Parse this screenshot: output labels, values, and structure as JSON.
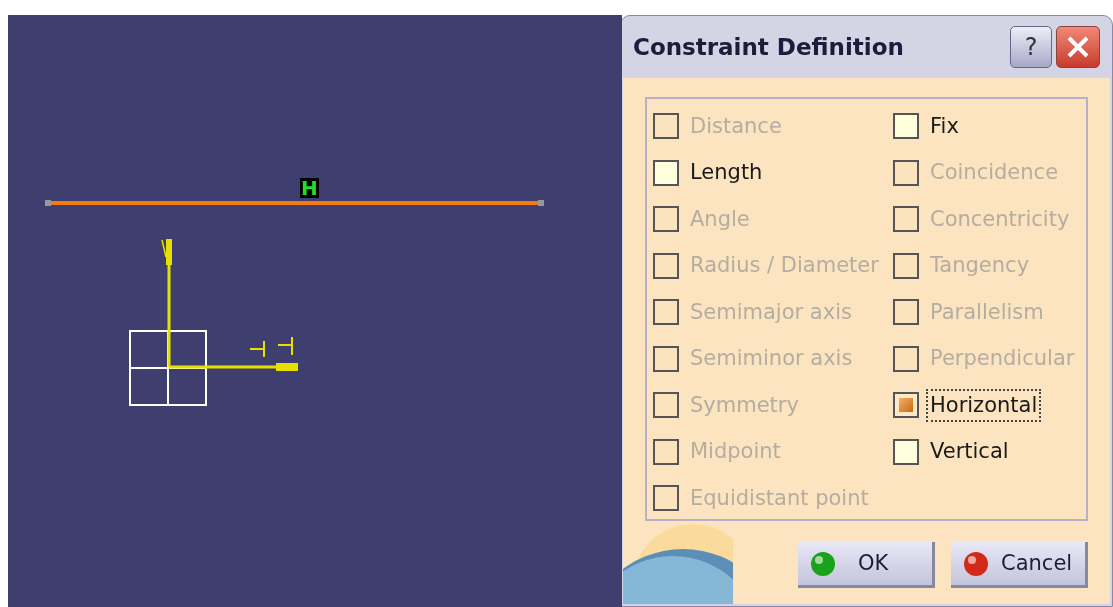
{
  "canvas": {
    "constraint_label": "H"
  },
  "dialog": {
    "title": "Constraint Definition",
    "help": "?",
    "columns": [
      [
        {
          "label": "Distance",
          "checked": false,
          "disabled": true,
          "focused": false
        },
        {
          "label": "Length",
          "checked": false,
          "disabled": false,
          "focused": false
        },
        {
          "label": "Angle",
          "checked": false,
          "disabled": true,
          "focused": false
        },
        {
          "label": "Radius / Diameter",
          "checked": false,
          "disabled": true,
          "focused": false
        },
        {
          "label": "Semimajor axis",
          "checked": false,
          "disabled": true,
          "focused": false
        },
        {
          "label": "Semiminor axis",
          "checked": false,
          "disabled": true,
          "focused": false
        },
        {
          "label": "Symmetry",
          "checked": false,
          "disabled": true,
          "focused": false
        },
        {
          "label": "Midpoint",
          "checked": false,
          "disabled": true,
          "focused": false
        },
        {
          "label": "Equidistant point",
          "checked": false,
          "disabled": true,
          "focused": false
        }
      ],
      [
        {
          "label": "Fix",
          "checked": false,
          "disabled": false,
          "focused": false
        },
        {
          "label": "Coincidence",
          "checked": false,
          "disabled": true,
          "focused": false
        },
        {
          "label": "Concentricity",
          "checked": false,
          "disabled": true,
          "focused": false
        },
        {
          "label": "Tangency",
          "checked": false,
          "disabled": true,
          "focused": false
        },
        {
          "label": "Parallelism",
          "checked": false,
          "disabled": true,
          "focused": false
        },
        {
          "label": "Perpendicular",
          "checked": false,
          "disabled": true,
          "focused": false
        },
        {
          "label": "Horizontal",
          "checked": true,
          "disabled": false,
          "focused": true
        },
        {
          "label": "Vertical",
          "checked": false,
          "disabled": false,
          "focused": false
        }
      ]
    ],
    "buttons": [
      {
        "kind": "ok",
        "label": "OK"
      },
      {
        "kind": "cancel",
        "label": "Cancel"
      }
    ]
  }
}
